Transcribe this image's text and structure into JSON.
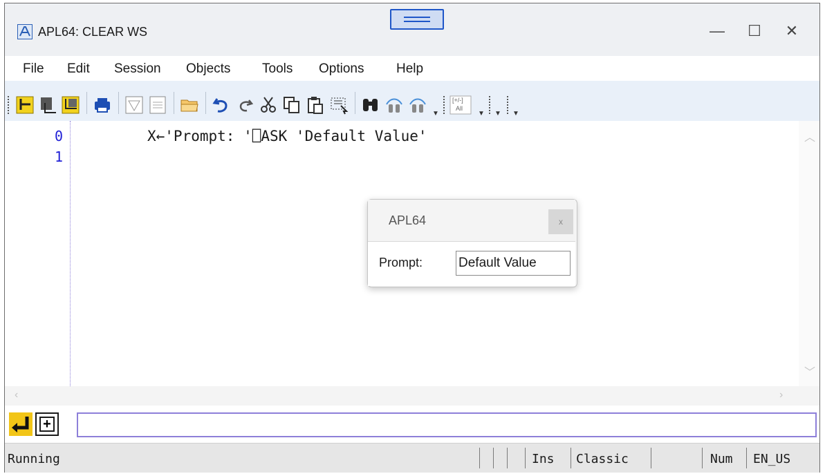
{
  "window": {
    "title": "APL64: CLEAR WS",
    "minimize": "—",
    "maximize": "☐",
    "close": "✕"
  },
  "menu": [
    "File",
    "Edit",
    "Session",
    "Objects",
    "Tools",
    "Options",
    "Help"
  ],
  "toolbar": {
    "icons": [
      "line-start-icon",
      "line-down-icon",
      "line-end-icon",
      "print-icon",
      "filter-icon",
      "document-icon",
      "open-folder-icon",
      "undo-icon",
      "redo-icon",
      "cut-icon",
      "copy-icon",
      "paste-icon",
      "select-icon",
      "find-icon",
      "find-prev-icon",
      "find-next-icon",
      "toggle-all-icon"
    ],
    "toggle_label_top": "[+/-]",
    "toggle_label_bottom": "All"
  },
  "editor": {
    "lines": [
      {
        "number": "0",
        "code": "X←'Prompt: '⎕ASK 'Default Value'"
      },
      {
        "number": "1",
        "code": ""
      }
    ]
  },
  "dialog": {
    "title": "APL64",
    "close": "x",
    "label": "Prompt:",
    "value": "Default Value"
  },
  "status": {
    "left": "Running",
    "mode": "Ins",
    "keyboard": "Classic",
    "numlock": "Num",
    "locale": "EN_US"
  },
  "colors": {
    "line_numbers": "#1f1fd6",
    "toolbar_bg": "#e9f0f9",
    "accent_yellow": "#f2c517",
    "grip_blue": "#1e56c8"
  }
}
